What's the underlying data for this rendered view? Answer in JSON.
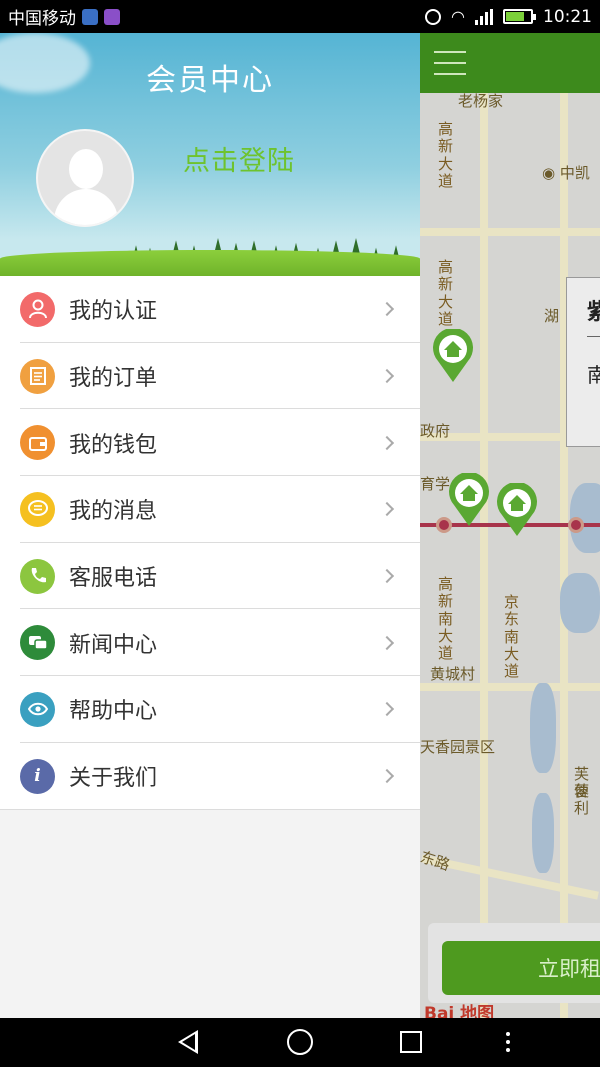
{
  "status_bar": {
    "carrier": "中国移动",
    "time": "10:21",
    "network": "G"
  },
  "drawer": {
    "title": "会员中心",
    "login_text": "点击登陆",
    "menu": [
      {
        "label": "我的认证",
        "icon": "user-icon",
        "color": "#f26a6a"
      },
      {
        "label": "我的订单",
        "icon": "order-list-icon",
        "color": "#f0a040"
      },
      {
        "label": "我的钱包",
        "icon": "wallet-icon",
        "color": "#f09030"
      },
      {
        "label": "我的消息",
        "icon": "message-icon",
        "color": "#f5c020"
      },
      {
        "label": "客服电话",
        "icon": "phone-icon",
        "color": "#8cc63f"
      },
      {
        "label": "新闻中心",
        "icon": "news-icon",
        "color": "#2e8b3a"
      },
      {
        "label": "帮助中心",
        "icon": "help-eye-icon",
        "color": "#3aa0c0"
      },
      {
        "label": "关于我们",
        "icon": "info-icon",
        "color": "#5a6aa8"
      }
    ]
  },
  "map": {
    "labels": {
      "l1": "老杨家",
      "l2": "高新大道",
      "l3": "中凯",
      "l4": "高新大道",
      "l5": "湖",
      "l6": "政府",
      "l7": "育学",
      "l8": "高新南大道",
      "l9": "京东南大道",
      "l10": "黄城村",
      "l11": "天香园景区",
      "l12": "芙蓉",
      "l13": "便利",
      "l14": "东路"
    },
    "popup_title": "紫",
    "popup_sub": "南",
    "rent_button": "立即租",
    "logo_text": "Bai 地图"
  }
}
